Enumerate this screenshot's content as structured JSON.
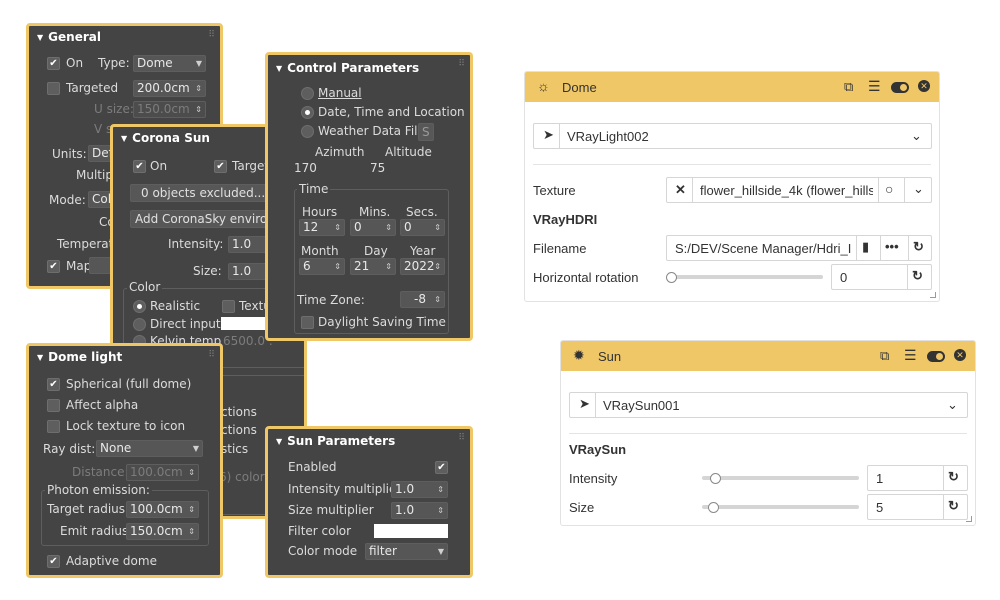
{
  "general": {
    "title": "General",
    "on": "On",
    "type_label": "Type:",
    "type_value": "Dome",
    "targeted": "Targeted",
    "targeted_value": "200.0cm",
    "usize_label": "U size:",
    "usize_value": "150.0cm",
    "vsize_label": "V s",
    "units_label": "Units:",
    "units_value": "Def",
    "multiplier": "Multipl",
    "mode_label": "Mode:",
    "mode_value": "Col",
    "co": "Co",
    "temperature": "Temperatu",
    "map": "Map"
  },
  "corona": {
    "title": "Corona Sun",
    "on": "On",
    "targeted": "Targete",
    "excluded": "0 objects excluded...",
    "add_sky": "Add CoronaSky environmen",
    "intensity_label": "Intensity:",
    "intensity_value": "1.0",
    "size_label": "Size:",
    "size_value": "1.0",
    "color_group": "Color",
    "realistic": "Realistic",
    "texture": "Textu",
    "direct_input": "Direct input",
    "kelvin": "Kelvin temp",
    "kelvin_value": "6500.0 :",
    "ctions1": "ctions",
    "ctions2": "ctions",
    "stics": "stics",
    "color6": "6) color"
  },
  "control": {
    "title": "Control Parameters",
    "manual": "Manual",
    "date_time": "Date, Time and Location",
    "weather": "Weather Data File",
    "weather_btn": "S",
    "azimuth_label": "Azimuth",
    "altitude_label": "Altitude",
    "azimuth_value": "170",
    "altitude_value": "75",
    "time_group": "Time",
    "hours_label": "Hours",
    "mins_label": "Mins.",
    "secs_label": "Secs.",
    "hours": "12",
    "mins": "0",
    "secs": "0",
    "month_label": "Month",
    "day_label": "Day",
    "year_label": "Year",
    "month": "6",
    "day": "21",
    "year": "2022",
    "timezone_label": "Time Zone:",
    "timezone": "-8",
    "dst": "Daylight Saving Time"
  },
  "dome": {
    "title": "Dome light",
    "spherical": "Spherical (full dome)",
    "affect_alpha": "Affect alpha",
    "lock_texture": "Lock texture to icon",
    "raydist_label": "Ray dist:",
    "raydist_value": "None",
    "distance_label": "Distance:",
    "distance_value": "100.0cm",
    "photon_group": "Photon emission:",
    "target_radius_label": "Target radius:",
    "target_radius": "100.0cm",
    "emit_radius_label": "Emit radius:",
    "emit_radius": "150.0cm",
    "adaptive": "Adaptive dome"
  },
  "sunparams": {
    "title": "Sun Parameters",
    "enabled": "Enabled",
    "intensity_label": "Intensity multiplier",
    "intensity": "1.0",
    "size_label": "Size multiplier",
    "size": "1.0",
    "filter_label": "Filter color",
    "color_mode_label": "Color mode",
    "color_mode": "filter"
  },
  "dome_card": {
    "title": "Dome",
    "object": "VRayLight002",
    "texture_label": "Texture",
    "texture_value": "flower_hillside_4k (flower_hills",
    "section": "VRayHDRI",
    "filename_label": "Filename",
    "filename_value": "S:/DEV/Scene Manager/Hdri_I",
    "rotation_label": "Horizontal rotation",
    "rotation_value": "0",
    "rotation_level": 0
  },
  "sun_card": {
    "title": "Sun",
    "object": "VRaySun001",
    "section": "VRaySun",
    "intensity_label": "Intensity",
    "intensity_value": "1",
    "intensity_level": 0.05,
    "size_label": "Size",
    "size_value": "5",
    "size_level": 0.04
  },
  "colors": {
    "accent": "#efc767",
    "panel_bg": "#444444",
    "card_bg": "#ffffff"
  }
}
